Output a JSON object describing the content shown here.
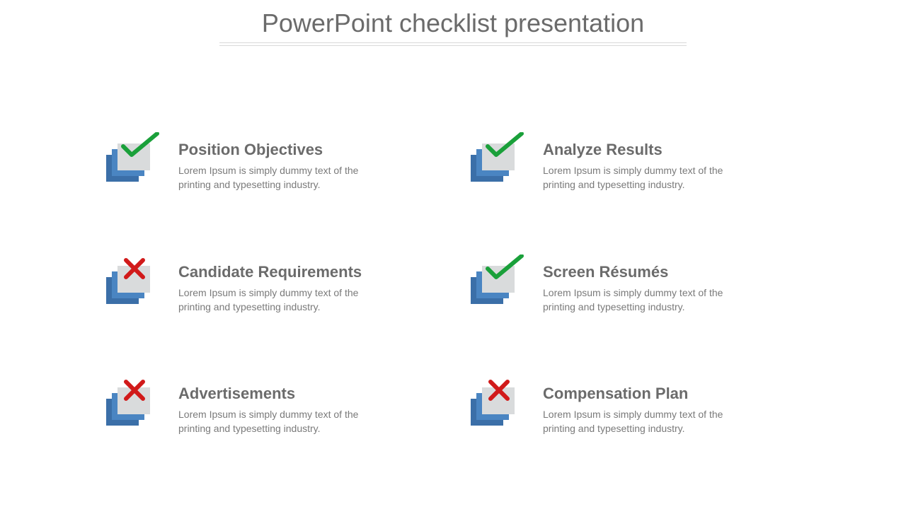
{
  "title": "PowerPoint checklist presentation",
  "items": [
    {
      "title": "Position Objectives",
      "desc": "Lorem Ipsum is simply dummy text of the printing and typesetting industry.",
      "status": "check"
    },
    {
      "title": "Analyze Results",
      "desc": "Lorem Ipsum is simply dummy text of the printing and typesetting industry.",
      "status": "check"
    },
    {
      "title": "Candidate Requirements",
      "desc": "Lorem Ipsum is simply dummy text of the printing and typesetting industry.",
      "status": "cross"
    },
    {
      "title": "Screen Résumés",
      "desc": "Lorem Ipsum is simply dummy text of the printing and typesetting industry.",
      "status": "check"
    },
    {
      "title": "Advertisements",
      "desc": "Lorem Ipsum is simply dummy text of the printing and typesetting industry.",
      "status": "cross"
    },
    {
      "title": "Compensation Plan",
      "desc": "Lorem Ipsum is simply dummy text of the printing and typesetting industry.",
      "status": "cross"
    }
  ],
  "colors": {
    "check": "#1aa03a",
    "cross": "#d11a1a"
  }
}
